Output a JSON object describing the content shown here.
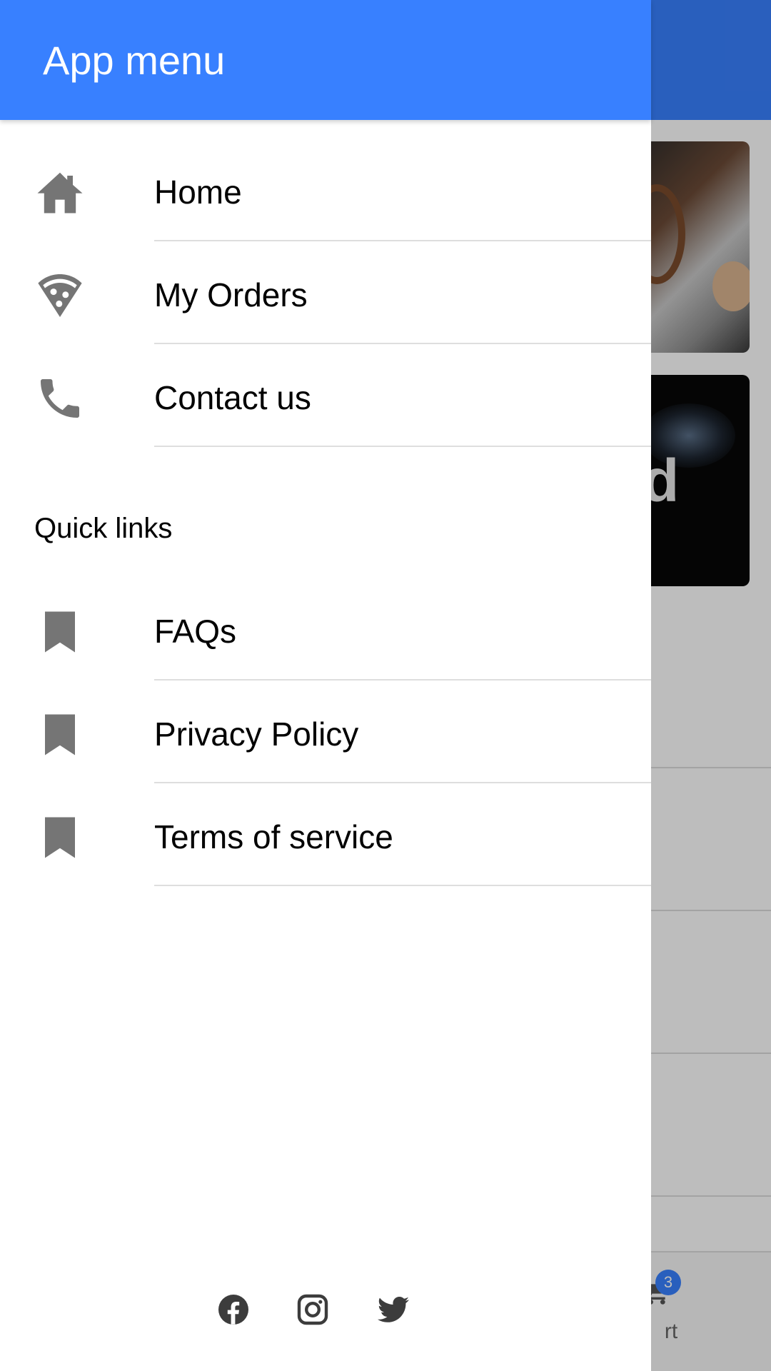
{
  "menu": {
    "title": "App menu",
    "items": [
      {
        "label": "Home",
        "icon": "home-icon"
      },
      {
        "label": "My Orders",
        "icon": "pizza-icon"
      },
      {
        "label": "Contact us",
        "icon": "phone-icon"
      }
    ],
    "quick_links_header": "Quick links",
    "quick_links": [
      {
        "label": "FAQs",
        "icon": "bookmark-icon"
      },
      {
        "label": "Privacy Policy",
        "icon": "bookmark-icon"
      },
      {
        "label": "Terms of service",
        "icon": "bookmark-icon"
      }
    ],
    "social": [
      "facebook-icon",
      "instagram-icon",
      "twitter-icon"
    ]
  },
  "background": {
    "card_text_fragment": "d",
    "cart_badge_count": "3",
    "cart_label_fragment": "rt"
  },
  "colors": {
    "accent": "#3880ff",
    "icon_gray": "#757575",
    "divider": "#dedede"
  }
}
